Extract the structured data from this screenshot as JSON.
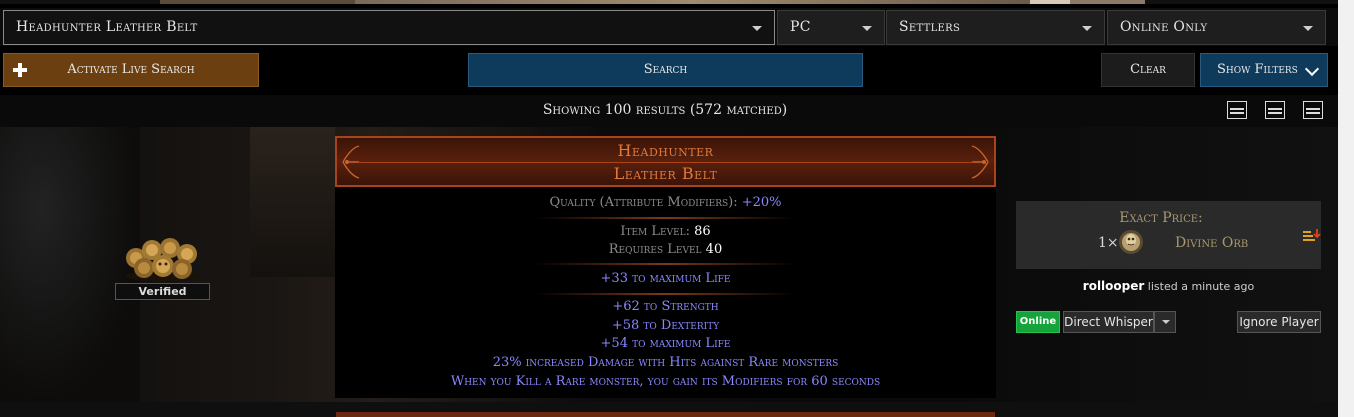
{
  "search": {
    "item_name": "Headhunter Leather Belt",
    "platform": "PC",
    "league": "Settlers",
    "status_filter": "Online Only"
  },
  "actions": {
    "live_search": "Activate Live Search",
    "search": "Search",
    "clear": "Clear",
    "show_filters": "Show Filters"
  },
  "results": {
    "summary": "Showing 100 results (572 matched)"
  },
  "listing": {
    "verified": "Verified",
    "item": {
      "name": "Headhunter",
      "base": "Leather Belt",
      "quality_label": "Quality (Attribute Modifiers): ",
      "quality_value": "+20%",
      "item_level_label": "Item Level: ",
      "item_level": "86",
      "requires_label": "Requires Level ",
      "requires_value": "40",
      "implicit": "+33 to maximum Life",
      "mods": [
        "+62 to Strength",
        "+58 to Dexterity",
        "+54 to maximum Life",
        "23% increased Damage with Hits against Rare monsters",
        "When you Kill a Rare monster, you gain its Modifiers for 60 seconds"
      ]
    },
    "price": {
      "label": "Exact Price:",
      "amount": "1×",
      "currency": "Divine Orb"
    },
    "seller": {
      "name": "rollooper",
      "listed": " listed a minute ago"
    },
    "buttons": {
      "online": "Online",
      "whisper": "Direct Whisper",
      "ignore": "Ignore Player"
    }
  },
  "colors": {
    "unique_orange": "#e07a3a",
    "magic_blue": "#8888ff",
    "search_blue": "#0e3a5c",
    "live_orange": "#6b3f10",
    "online_green": "#17a33c"
  }
}
